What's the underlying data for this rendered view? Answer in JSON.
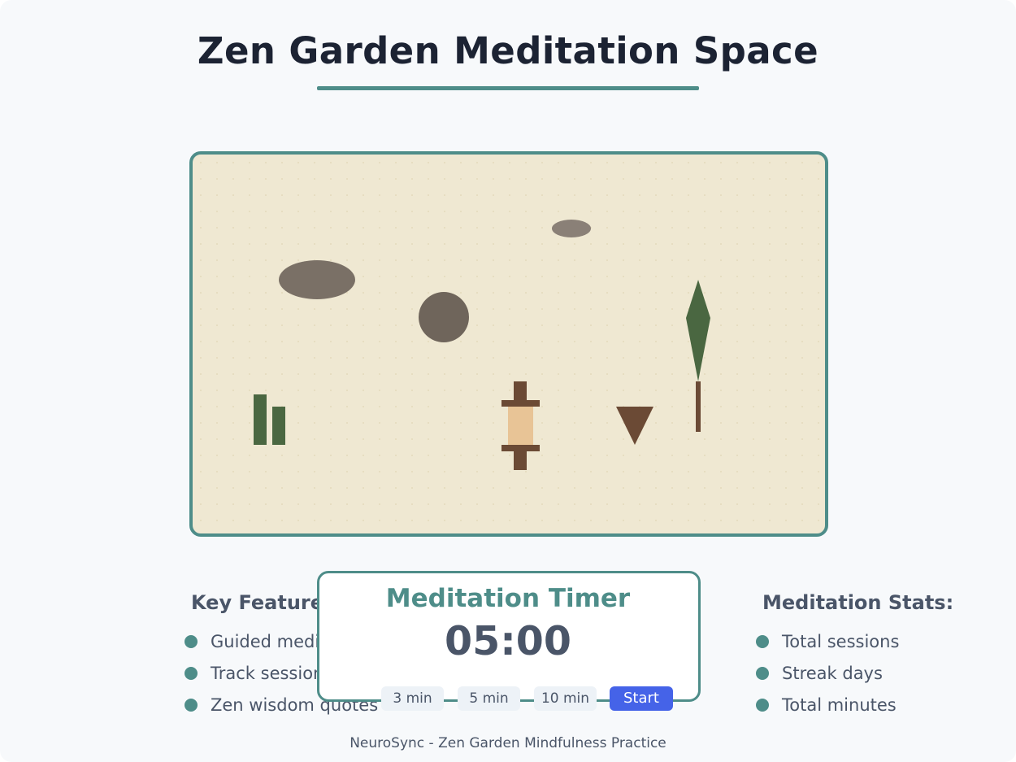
{
  "header": {
    "title": "Zen Garden Meditation Space"
  },
  "garden": {
    "elements": [
      {
        "name": "stone",
        "icon": "large-flat-stone"
      },
      {
        "name": "stone",
        "icon": "small-flat-stone"
      },
      {
        "name": "stone",
        "icon": "round-stone"
      },
      {
        "name": "tree",
        "icon": "cypress-tree"
      },
      {
        "name": "bamboo",
        "icon": "bamboo-stalks"
      },
      {
        "name": "lantern",
        "icon": "stone-lantern"
      },
      {
        "name": "marker",
        "icon": "triangle-marker"
      }
    ],
    "colors": {
      "sand": "#efe8d2",
      "border": "#4e8d89",
      "stone": "#7a7066",
      "plant": "#4a6741",
      "wood": "#6b4a35",
      "lantern_glow": "#e8c496"
    }
  },
  "features": {
    "heading": "Key Features:",
    "items": [
      "Guided meditation",
      "Track sessions",
      "Zen wisdom quotes"
    ]
  },
  "timer": {
    "title": "Meditation Timer",
    "display": "05:00",
    "presets": [
      "3 min",
      "5 min",
      "10 min"
    ],
    "start_label": "Start"
  },
  "stats": {
    "heading": "Meditation Stats:",
    "items": [
      "Total sessions",
      "Streak days",
      "Total minutes"
    ]
  },
  "footer": {
    "text": "NeuroSync - Zen Garden Mindfulness Practice"
  },
  "theme": {
    "accent": "#4e8d89",
    "button_primary": "#4563e8",
    "text": "#4a5568"
  }
}
